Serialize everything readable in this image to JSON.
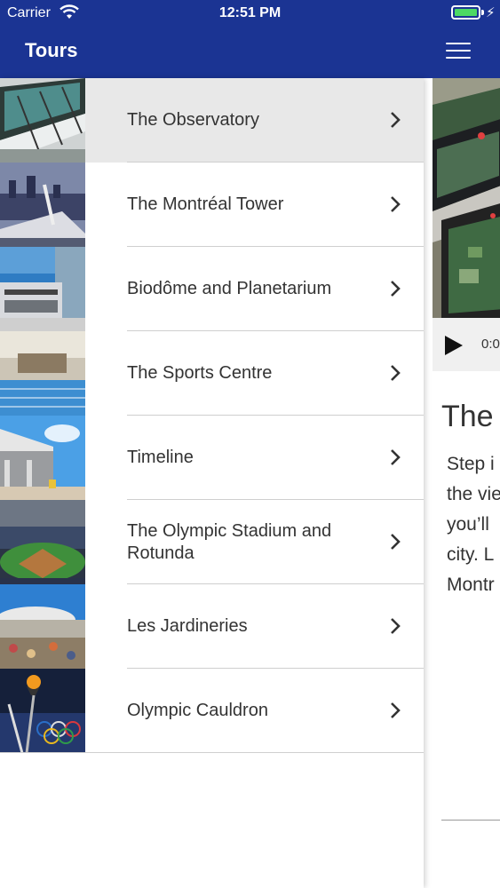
{
  "status_bar": {
    "carrier": "Carrier",
    "time": "12:51 PM",
    "battery_level": 1.0,
    "battery_color": "#4cd964",
    "charging": true
  },
  "nav": {
    "title": "Tours",
    "background": "#1b3493",
    "menu_icon": "hamburger-icon"
  },
  "drawer": {
    "items": [
      {
        "label": "The Observatory",
        "selected": true,
        "icon": "chevron-right-icon"
      },
      {
        "label": "The Montréal Tower",
        "selected": false,
        "icon": "chevron-right-icon"
      },
      {
        "label": "Biodôme and Planetarium",
        "selected": false,
        "icon": "chevron-right-icon"
      },
      {
        "label": "The Sports Centre",
        "selected": false,
        "icon": "chevron-right-icon"
      },
      {
        "label": "Timeline",
        "selected": false,
        "icon": "chevron-right-icon"
      },
      {
        "label": "The Olympic Stadium and Rotunda",
        "selected": false,
        "icon": "chevron-right-icon"
      },
      {
        "label": "Les Jardineries",
        "selected": false,
        "icon": "chevron-right-icon"
      },
      {
        "label": "Olympic Cauldron",
        "selected": false,
        "icon": "chevron-right-icon"
      }
    ]
  },
  "detail": {
    "player_time": "0:0",
    "title_fragment": "The",
    "body_lines": [
      "Step i",
      "the vie",
      "you’ll",
      "city. L",
      "Montr"
    ]
  }
}
